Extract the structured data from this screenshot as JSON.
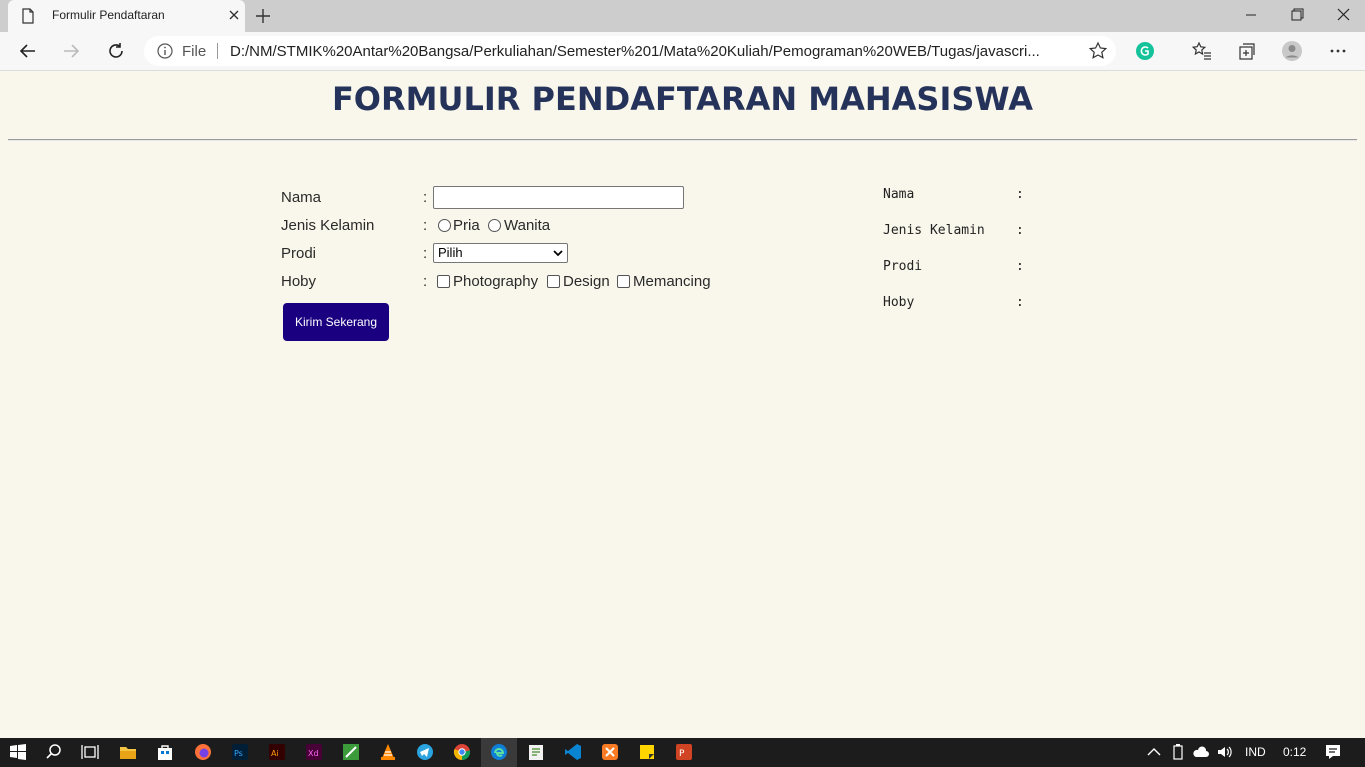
{
  "browser": {
    "tab_title": "Formulir Pendaftaran",
    "address_scheme": "File",
    "address_url": "D:/NM/STMIK%20Antar%20Bangsa/Perkuliahan/Semester%201/Mata%20Kuliah/Pemograman%20WEB/Tugas/javascri...",
    "accent": "#1a73e8"
  },
  "page": {
    "title": "FORMULIR PENDAFTARAN MAHASISWA",
    "title_color": "#25335a",
    "background": "#f9f7eb"
  },
  "form": {
    "colon": ":",
    "nama_label": "Nama",
    "nama_value": "",
    "jk_label": "Jenis Kelamin",
    "jk_options": [
      "Pria",
      "Wanita"
    ],
    "prodi_label": "Prodi",
    "prodi_selected": "Pilih",
    "hoby_label": "Hoby",
    "hoby_options": [
      "Photography",
      "Design",
      "Memancing"
    ],
    "submit_label": "Kirim Sekerang",
    "submit_color": "#1a0080"
  },
  "output": {
    "colon": ":",
    "rows": [
      "Nama",
      "Jenis Kelamin",
      "Prodi",
      "Hoby"
    ]
  },
  "taskbar": {
    "language": "IND",
    "time": "0:12"
  },
  "icons": [
    "page-icon",
    "close-icon",
    "plus-icon",
    "minimize-icon",
    "restore-icon",
    "back-arrow-icon",
    "forward-arrow-icon",
    "refresh-icon",
    "info-icon",
    "star-icon",
    "grammarly-icon",
    "favorites-icon",
    "collections-icon",
    "profile-icon",
    "more-icon",
    "windows-start-icon",
    "search-icon",
    "task-view-icon",
    "file-explorer-icon",
    "store-icon",
    "firefox-icon",
    "photoshop-icon",
    "illustrator-icon",
    "xd-icon",
    "notepad-icon",
    "vlc-icon",
    "telegram-icon",
    "chrome-icon",
    "edge-icon",
    "notes-icon",
    "vscode-icon",
    "xampp-icon",
    "sticky-notes-icon",
    "powerpoint-icon",
    "chevron-up-icon",
    "battery-icon",
    "cloud-icon",
    "volume-icon",
    "notification-icon"
  ]
}
